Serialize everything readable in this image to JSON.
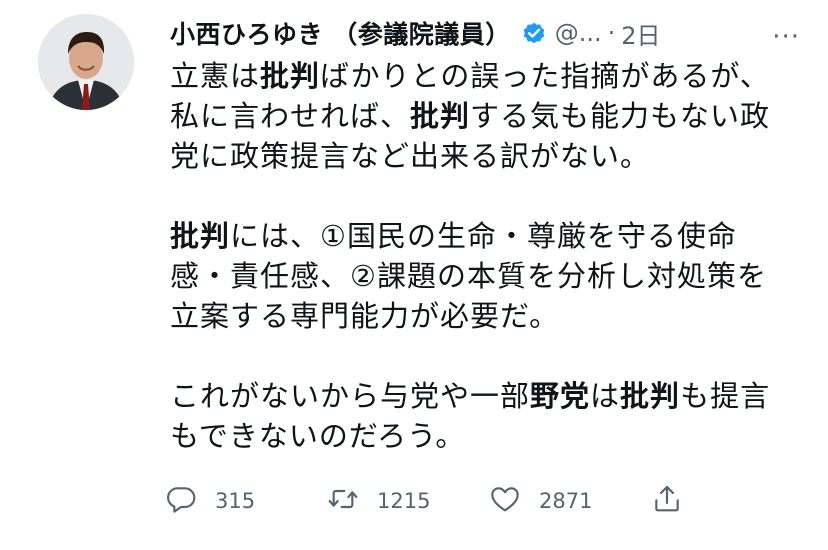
{
  "tweet": {
    "display_name": "小西ひろゆき （参議院議員）",
    "handle": "@...",
    "separator": "·",
    "time": "2日",
    "more_label": "···",
    "paragraphs": [
      {
        "lines": [
          [
            {
              "t": "立憲は"
            },
            {
              "t": "批判",
              "b": true
            },
            {
              "t": "ばかりとの誤った指摘があるが、"
            }
          ],
          [
            {
              "t": "私に言わせれば、"
            },
            {
              "t": "批判",
              "b": true
            },
            {
              "t": "する気も能力もない政"
            }
          ],
          [
            {
              "t": "党に政策提言など出来る訳がない。"
            }
          ]
        ]
      },
      {
        "lines": [
          [
            {
              "t": "批判",
              "b": true
            },
            {
              "t": "には、①国民の生命・尊厳を守る使命"
            }
          ],
          [
            {
              "t": "感・責任感、②課題の本質を分析し対処策を"
            }
          ],
          [
            {
              "t": "立案する専門能力が必要だ。"
            }
          ]
        ]
      },
      {
        "lines": [
          [
            {
              "t": "これがないから与党や一部"
            },
            {
              "t": "野党",
              "b": true
            },
            {
              "t": "は"
            },
            {
              "t": "批判",
              "b": true
            },
            {
              "t": "も提言"
            }
          ],
          [
            {
              "t": "もできないのだろう。"
            }
          ]
        ]
      }
    ],
    "actions": {
      "reply_count": "315",
      "retweet_count": "1215",
      "like_count": "2871"
    }
  },
  "colors": {
    "text": "#0f1419",
    "secondary": "#536471",
    "verified": "#1d9bf0"
  },
  "icons": [
    "verified-badge-icon",
    "more-icon",
    "reply-icon",
    "retweet-icon",
    "like-icon",
    "share-icon"
  ]
}
